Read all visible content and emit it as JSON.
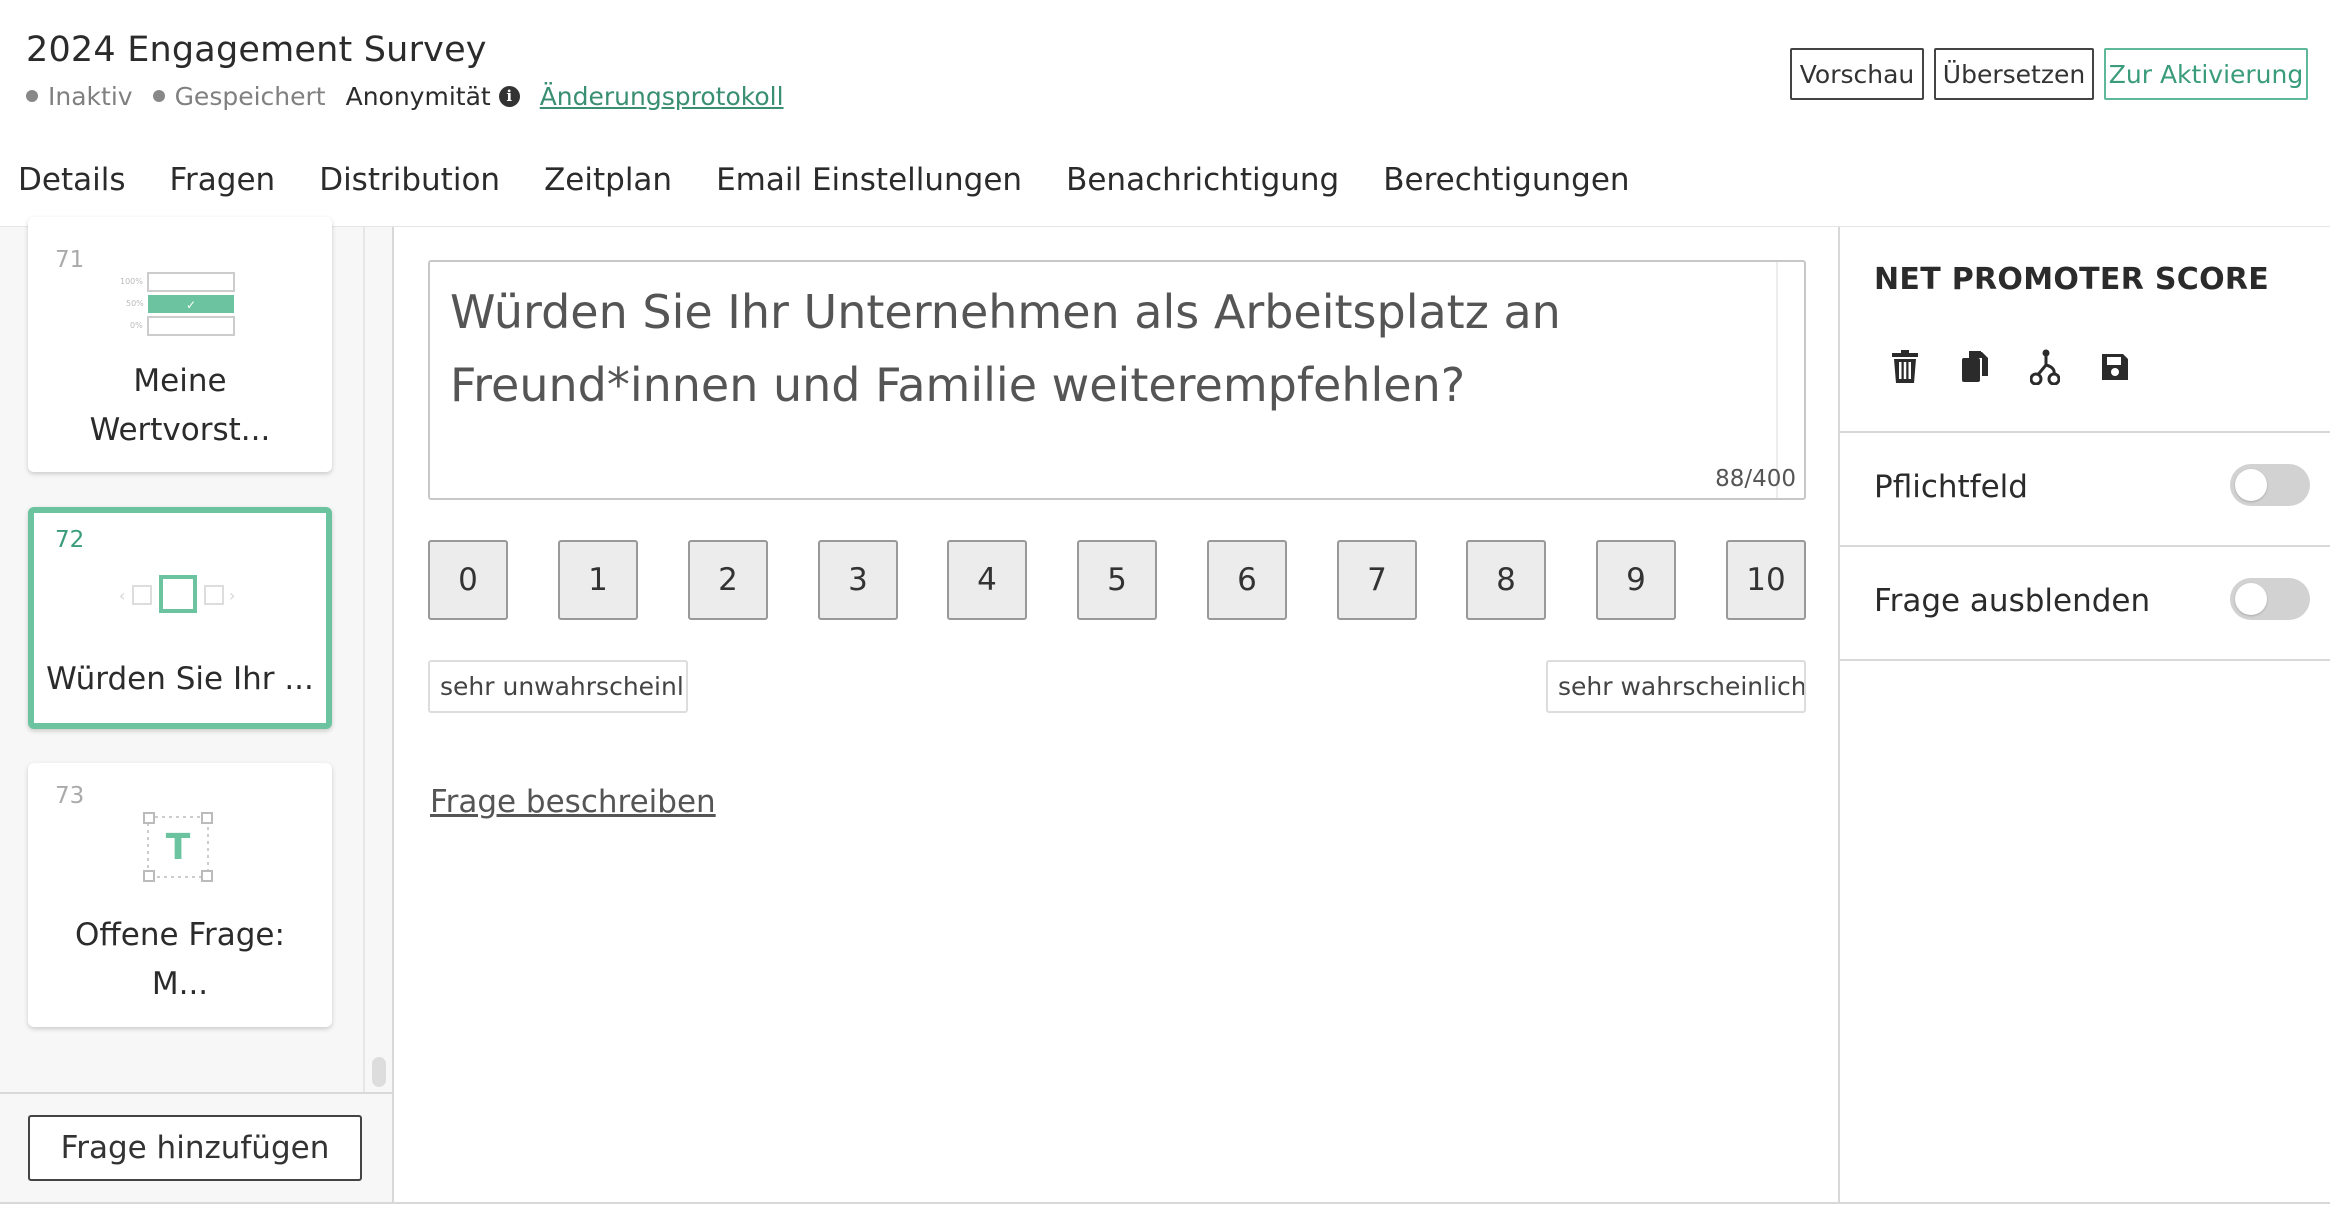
{
  "header": {
    "title": "2024 Engagement Survey",
    "status_inactive": "Inaktiv",
    "status_saved": "Gespeichert",
    "anonymity": "Anonymität",
    "changelog_link": "Änderungsprotokoll",
    "buttons": {
      "preview": "Vorschau",
      "translate": "Übersetzen",
      "activate": "Zur Aktivierung"
    }
  },
  "tabs": [
    {
      "label": "Details",
      "active": false
    },
    {
      "label": "Fragen",
      "active": true
    },
    {
      "label": "Distribution",
      "active": false
    },
    {
      "label": "Zeitplan",
      "active": false
    },
    {
      "label": "Email Einstellungen",
      "active": false
    },
    {
      "label": "Benachrichtigung",
      "active": false
    },
    {
      "label": "Berechtigungen",
      "active": false
    }
  ],
  "question_list": [
    {
      "number": "71",
      "label_line1": "Meine",
      "label_line2": "Wertvorst...",
      "icon": "percentage-bar-icon"
    },
    {
      "number": "72",
      "label_line1": "Würden Sie Ihr ...",
      "icon": "slider-scale-icon",
      "active": true
    },
    {
      "number": "73",
      "label_line1": "Offene Frage:",
      "label_line2": "M...",
      "icon": "text-field-icon"
    }
  ],
  "add_question_label": "Frage hinzufügen",
  "question": {
    "text_line1": "Würden Sie Ihr Unternehmen als Arbeitsplatz an",
    "text_line2": "Freund*innen und Familie weiterempfehlen?",
    "char_count": "88/400",
    "scale": [
      "0",
      "1",
      "2",
      "3",
      "4",
      "5",
      "6",
      "7",
      "8",
      "9",
      "10"
    ],
    "low_label": "sehr unwahrscheinli",
    "high_label": "sehr wahrscheinlich",
    "describe_link": "Frage beschreiben"
  },
  "settings": {
    "title": "NET PROMOTER SCORE",
    "icons": [
      "trash-icon",
      "copy-icon",
      "branch-icon",
      "save-icon"
    ],
    "required_label": "Pflichtfeld",
    "required_on": false,
    "hide_label": "Frage ausblenden",
    "hide_on": false
  },
  "colors": {
    "accent": "#5fb897",
    "link": "#3a8f73"
  }
}
